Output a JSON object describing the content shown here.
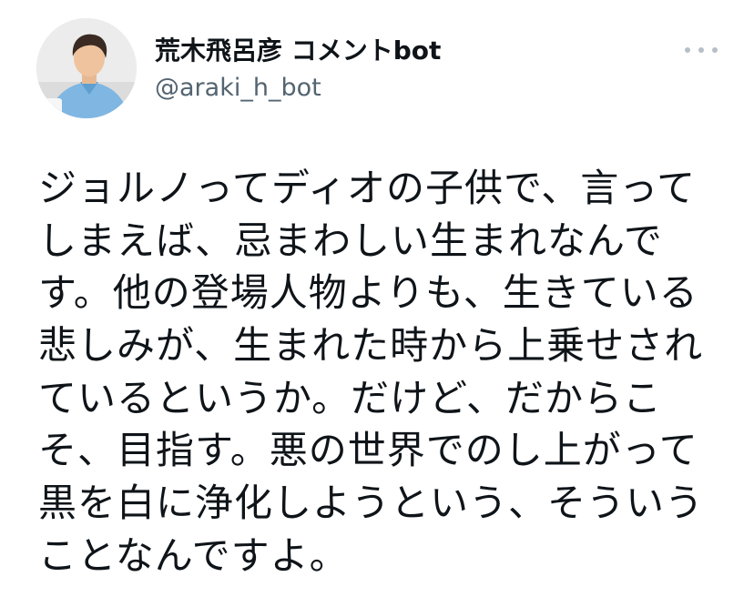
{
  "author": {
    "display_name": "荒木飛呂彦 コメントbot",
    "handle": "@araki_h_bot"
  },
  "tweet": {
    "lines": [
      "ジョルノってディオの子供で、言って",
      "しまえば、忌まわしい生まれなんで",
      "す。他の登場人物よりも、生きている",
      "悲しみが、生まれた時から上乗せされ",
      "ているというか。だけど、だからこ",
      "そ、目指す。悪の世界でのし上がって",
      "黒を白に浄化しようという、そういう",
      "ことなんですよ。"
    ]
  },
  "icons": {
    "more": "more-horizontal-icon",
    "avatar": "profile-photo"
  },
  "colors": {
    "text": "#0f1419",
    "secondary": "#536471",
    "more_dots": "#b6bfc7"
  }
}
